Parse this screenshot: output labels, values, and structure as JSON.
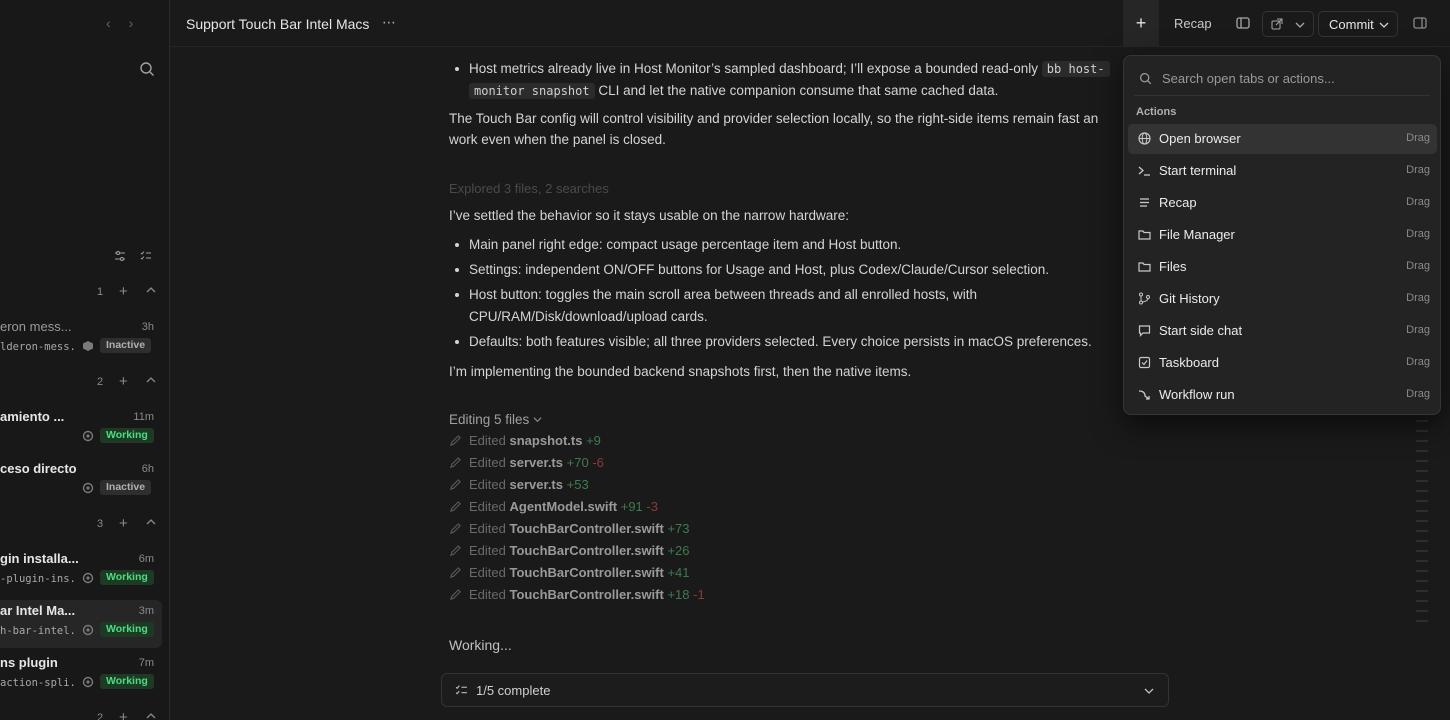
{
  "topbar": {
    "title": "Support Touch Bar Intel Macs",
    "recap_label": "Recap",
    "commit_label": "Commit"
  },
  "sidebar": {
    "groups": [
      {
        "number": "1"
      },
      {
        "number": "2"
      },
      {
        "number": "3"
      },
      {
        "number": "2"
      }
    ],
    "threads": [
      {
        "title": "eron mess...",
        "time": "3h",
        "branch": "lderon-mess...",
        "status": "Inactive"
      },
      {
        "title": "amiento ...",
        "time": "11m",
        "branch": "",
        "status": "Working"
      },
      {
        "title": "ceso directo",
        "time": "6h",
        "branch": "",
        "status": "Inactive"
      },
      {
        "title": "gin installa...",
        "time": "6m",
        "branch": "-plugin-ins...",
        "status": "Working"
      },
      {
        "title": "ar Intel Ma...",
        "time": "3m",
        "branch": "h-bar-intel...",
        "status": "Working"
      },
      {
        "title": "ns plugin",
        "time": "7m",
        "branch": "action-spli...",
        "status": "Working"
      }
    ]
  },
  "main": {
    "bullet_top": {
      "pre": "Host metrics already live in Host Monitor’s sampled dashboard; I’ll expose a bounded read-only ",
      "code1": "bb host-",
      "code2": "monitor snapshot",
      "post": " CLI and let the native companion consume that same cached data."
    },
    "para1_line1": "The Touch Bar config will control visibility and provider selection locally, so the right-side items remain fast an",
    "para1_line2": "work even when the panel is closed.",
    "explored": "Explored 3 files, 2 searches",
    "para2": "I’ve settled the behavior so it stays usable on the narrow hardware:",
    "bullets": [
      "Main panel right edge: compact usage percentage item and Host button.",
      "Settings: independent ON/OFF buttons for Usage and Host, plus Codex/Claude/Cursor selection.",
      "Host button: toggles the main scroll area between threads and all enrolled hosts, with",
      "CPU/RAM/Disk/download/upload cards.",
      "Defaults: both features visible; all three providers selected. Every choice persists in macOS preferences."
    ],
    "para3": "I’m implementing the bounded backend snapshots first, then the native items.",
    "edits_header": "Editing 5 files",
    "edited_prefix": "Edited",
    "edits": [
      {
        "file": "snapshot.ts",
        "add": "+9",
        "del": ""
      },
      {
        "file": "server.ts",
        "add": "+70",
        "del": "-6"
      },
      {
        "file": "server.ts",
        "add": "+53",
        "del": ""
      },
      {
        "file": "AgentModel.swift",
        "add": "+91",
        "del": "-3"
      },
      {
        "file": "TouchBarController.swift",
        "add": "+73",
        "del": ""
      },
      {
        "file": "TouchBarController.swift",
        "add": "+26",
        "del": ""
      },
      {
        "file": "TouchBarController.swift",
        "add": "+41",
        "del": ""
      },
      {
        "file": "TouchBarController.swift",
        "add": "+18",
        "del": "-1"
      }
    ],
    "working": "Working...",
    "progress_label": "1/5 complete"
  },
  "dropdown": {
    "search_placeholder": "Search open tabs or actions...",
    "section": "Actions",
    "drag_label": "Drag",
    "items": [
      {
        "label": "Open browser",
        "icon": "globe-icon"
      },
      {
        "label": "Start terminal",
        "icon": "terminal-icon"
      },
      {
        "label": "Recap",
        "icon": "lines-icon"
      },
      {
        "label": "File Manager",
        "icon": "folder-icon"
      },
      {
        "label": "Files",
        "icon": "folder-icon"
      },
      {
        "label": "Git History",
        "icon": "git-icon"
      },
      {
        "label": "Start side chat",
        "icon": "chat-icon"
      },
      {
        "label": "Taskboard",
        "icon": "taskboard-icon"
      },
      {
        "label": "Workflow run",
        "icon": "workflow-icon"
      }
    ]
  },
  "colors": {
    "background": "#1a1a1a",
    "working_badge": "#4ade80",
    "addition": "#3f7a4f",
    "deletion": "#8a3a3a"
  }
}
